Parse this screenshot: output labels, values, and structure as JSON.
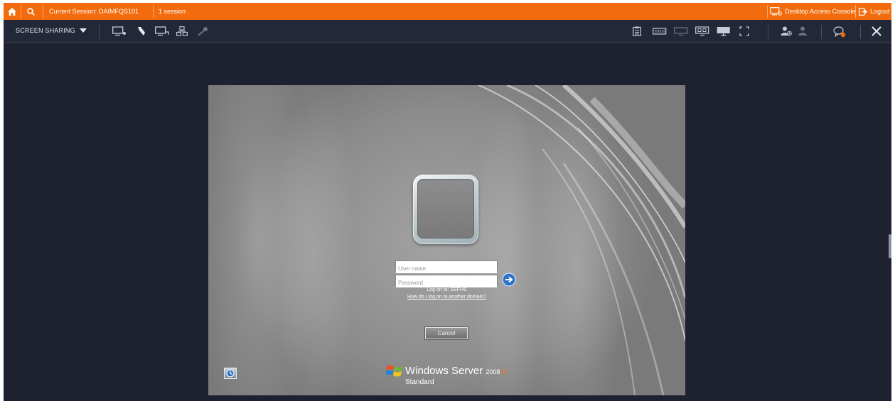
{
  "topbar": {
    "session_label": "Current Session: OAIMFQS101",
    "session_count": "1 session",
    "desktop_access_console": "Desktop Access Console",
    "logout": "Logout"
  },
  "toolbar": {
    "mode_label": "SCREEN SHARING"
  },
  "login": {
    "username_placeholder": "User name",
    "password_placeholder": "Password",
    "logon_to": "Log on to: SSFHS",
    "other_domain_link": "How do I log on to another domain?",
    "cancel_label": "Cancel"
  },
  "branding": {
    "product": "Windows Server",
    "version": "2008",
    "release": "R2",
    "edition": "Standard"
  },
  "colors": {
    "accent": "#f26b0c",
    "toolbar_bg": "#232838",
    "app_bg": "#1e2230"
  }
}
